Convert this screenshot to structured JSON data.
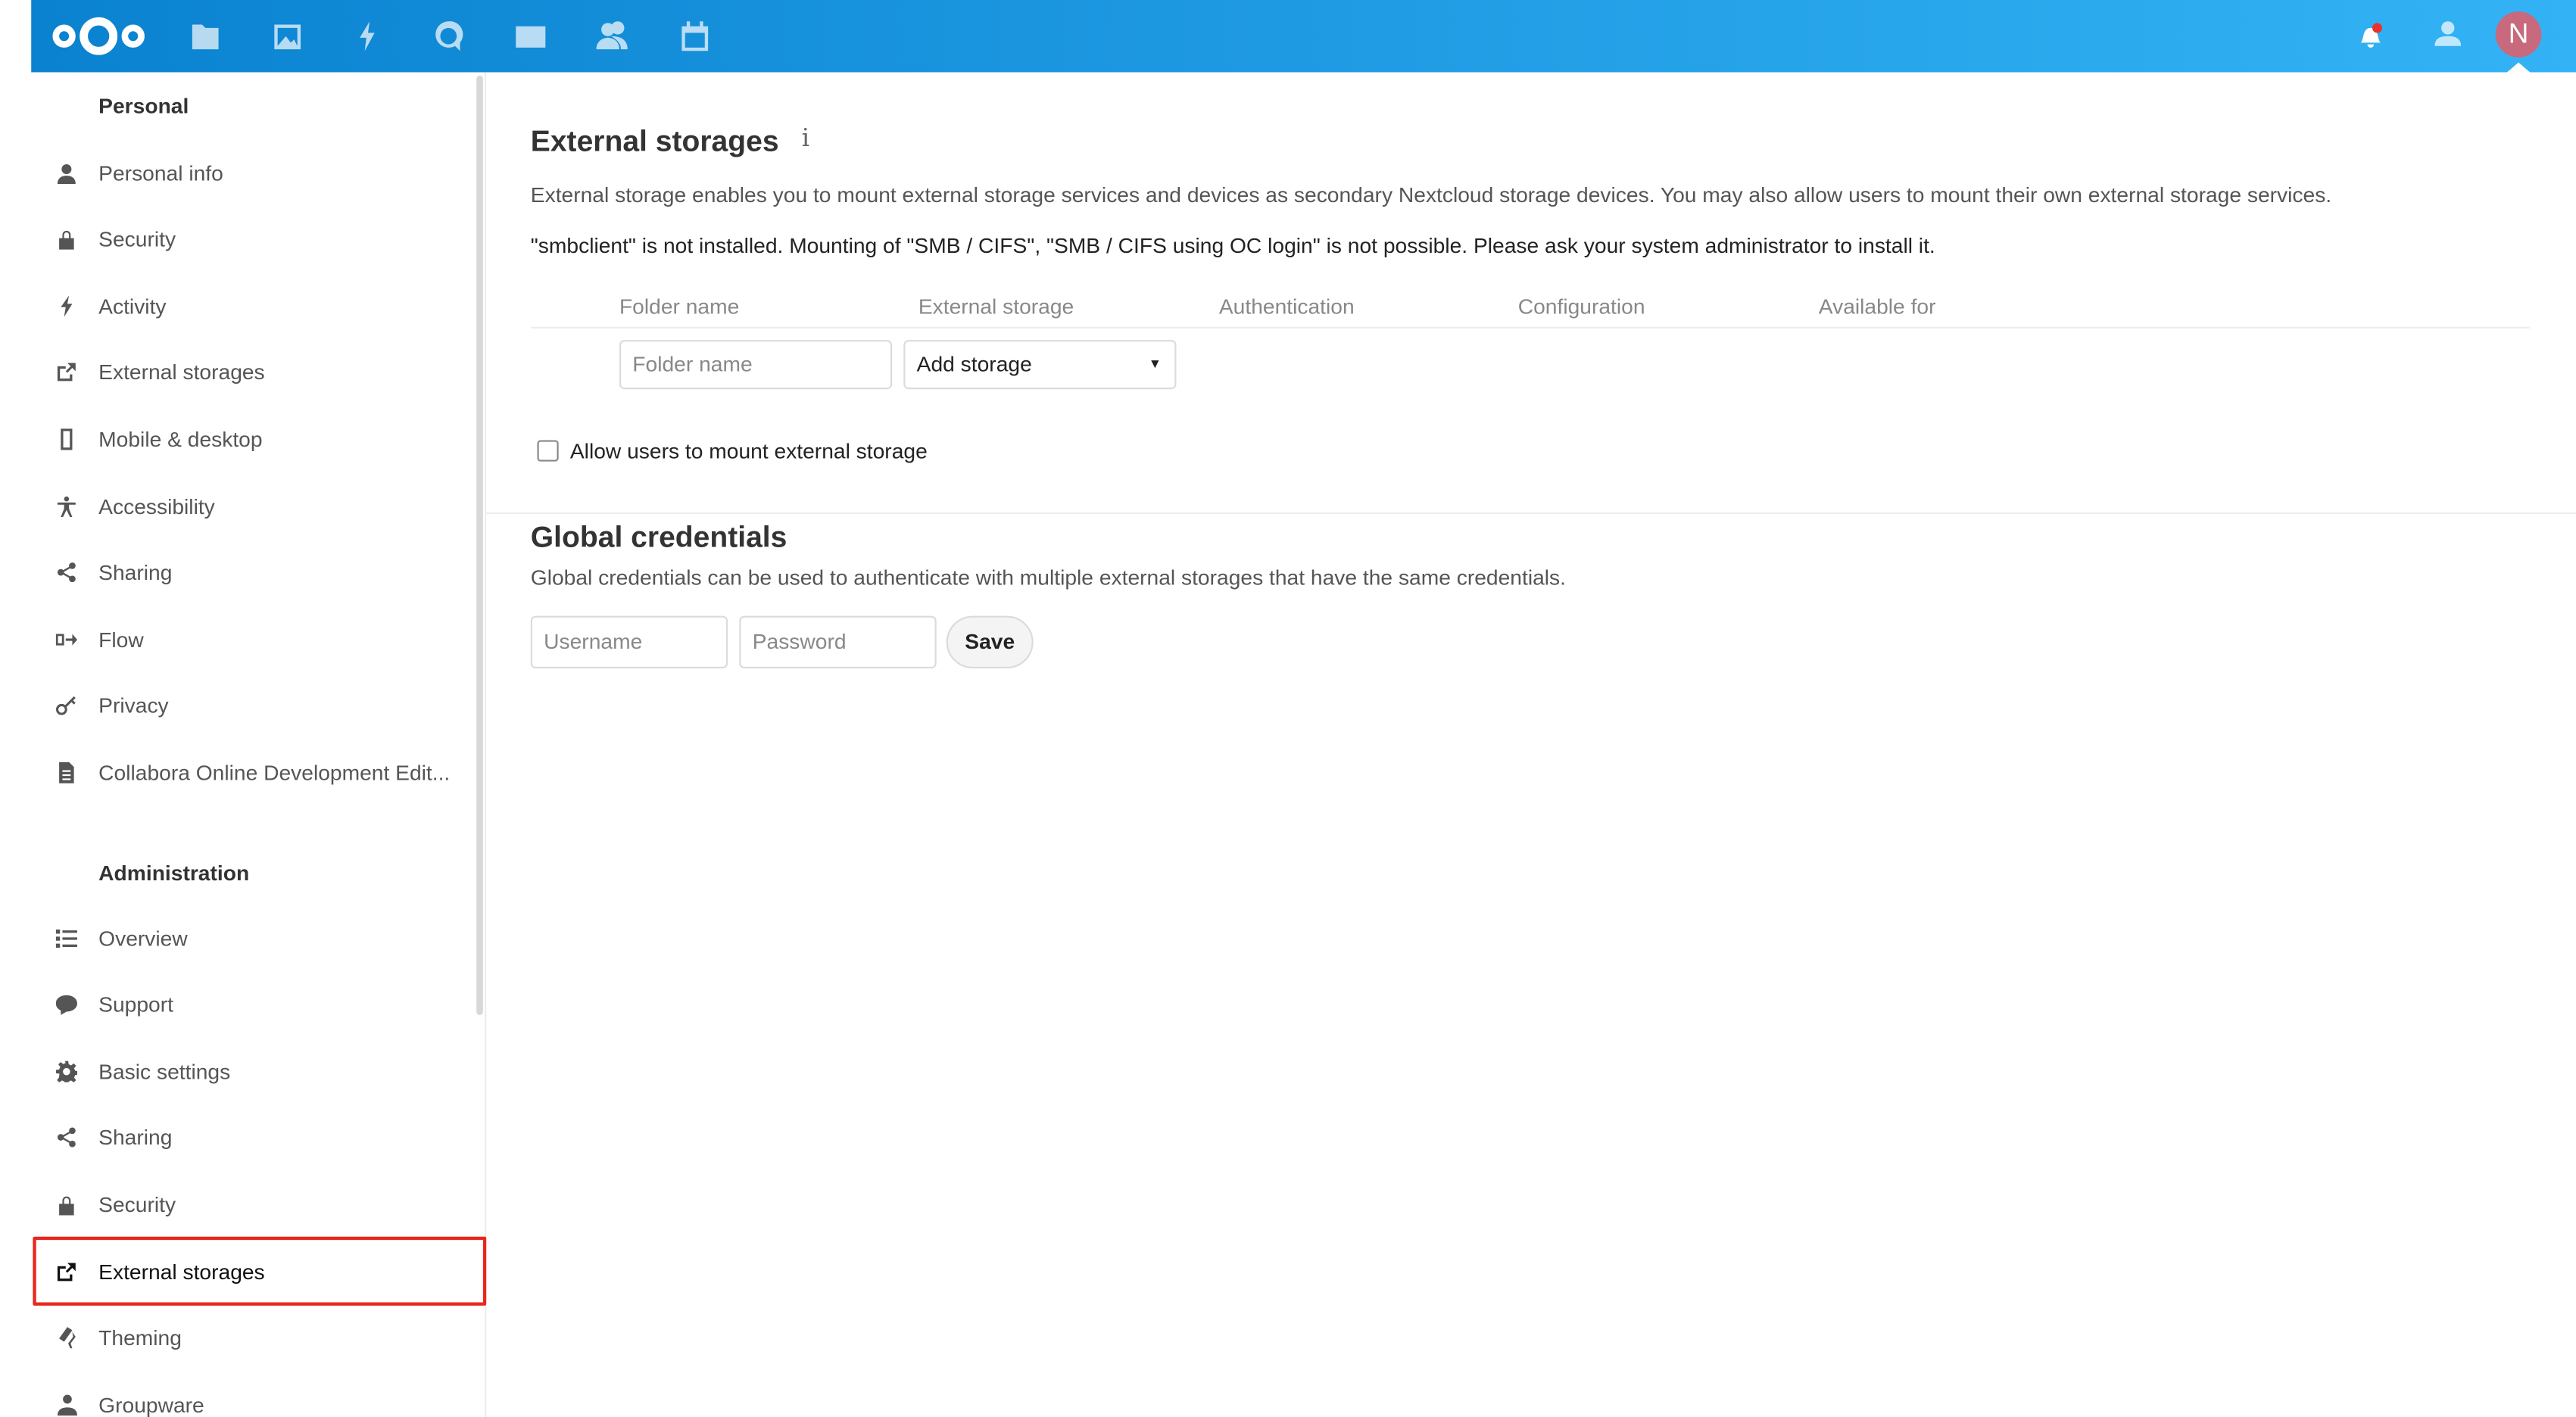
{
  "topbar": {
    "apps": [
      {
        "name": "files-icon"
      },
      {
        "name": "photos-icon"
      },
      {
        "name": "activity-icon"
      },
      {
        "name": "talk-icon"
      },
      {
        "name": "mail-icon"
      },
      {
        "name": "contacts-icon"
      },
      {
        "name": "calendar-icon"
      }
    ],
    "avatar_initial": "N",
    "accent": "#0082c9",
    "avatar_color": "#c8697d"
  },
  "sidebar": {
    "personal_title": "Personal",
    "personal": [
      {
        "label": "Personal info",
        "icon": "user-icon"
      },
      {
        "label": "Security",
        "icon": "lock-icon"
      },
      {
        "label": "Activity",
        "icon": "bolt-icon"
      },
      {
        "label": "External storages",
        "icon": "external-link-icon"
      },
      {
        "label": "Mobile & desktop",
        "icon": "phone-icon"
      },
      {
        "label": "Accessibility",
        "icon": "accessibility-icon"
      },
      {
        "label": "Sharing",
        "icon": "share-icon"
      },
      {
        "label": "Flow",
        "icon": "flow-icon"
      },
      {
        "label": "Privacy",
        "icon": "key-icon"
      },
      {
        "label": "Collabora Online Development Edit...",
        "icon": "document-icon"
      }
    ],
    "admin_title": "Administration",
    "admin": [
      {
        "label": "Overview",
        "icon": "list-icon"
      },
      {
        "label": "Support",
        "icon": "chat-icon"
      },
      {
        "label": "Basic settings",
        "icon": "gear-icon"
      },
      {
        "label": "Sharing",
        "icon": "share-icon"
      },
      {
        "label": "Security",
        "icon": "lock-icon"
      },
      {
        "label": "External storages",
        "icon": "external-link-icon",
        "active": true
      },
      {
        "label": "Theming",
        "icon": "paint-roller-icon"
      },
      {
        "label": "Groupware",
        "icon": "group-icon"
      }
    ]
  },
  "main": {
    "title": "External storages",
    "description": "External storage enables you to mount external storage services and devices as secondary Nextcloud storage devices. You may also allow users to mount their own external storage services.",
    "warning": "\"smbclient\" is not installed. Mounting of \"SMB / CIFS\", \"SMB / CIFS using OC login\" is not possible. Please ask your system administrator to install it.",
    "columns": [
      "Folder name",
      "External storage",
      "Authentication",
      "Configuration",
      "Available for"
    ],
    "folder_placeholder": "Folder name",
    "add_storage": "Add storage",
    "allow_users_label": "Allow users to mount external storage",
    "allow_users_checked": false,
    "global_title": "Global credentials",
    "global_desc": "Global credentials can be used to authenticate with multiple external storages that have the same credentials.",
    "username_placeholder": "Username",
    "password_placeholder": "Password",
    "save": "Save"
  }
}
